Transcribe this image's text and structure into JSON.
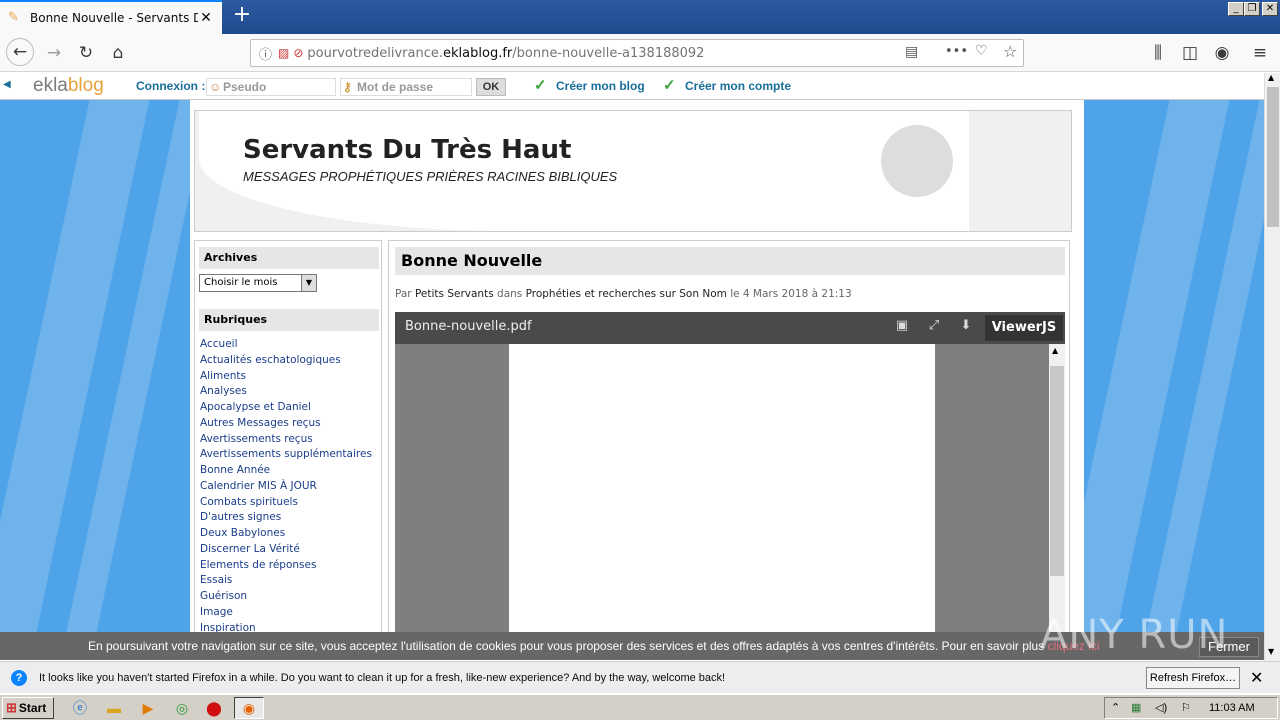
{
  "browser": {
    "tab_title": "Bonne Nouvelle - Servants Du Très Haut",
    "tab_title_visible": "Bonne Nouvelle - Servants Du Trè",
    "new_tab": "+",
    "url_plain_start": "pourvotredelivrance.",
    "url_domain": "eklablog.fr",
    "url_path": "/bonne-nouvelle-a138188092",
    "menu_dots": "•••"
  },
  "eklabar": {
    "logo_part1": "ekla",
    "logo_part2": "blog",
    "connexion_label": "Connexion :",
    "pseudo_placeholder": "Pseudo",
    "password_placeholder": "Mot de passe",
    "ok_label": "OK",
    "create_blog": "Créer mon blog",
    "create_account": "Créer mon compte"
  },
  "header": {
    "title": "Servants Du Très Haut",
    "subtitle": "MESSAGES PROPHÉTIQUES PRIÈRES RACINES BIBLIQUES"
  },
  "sidebar": {
    "archives_title": "Archives",
    "archives_select": "Choisir le mois",
    "rubriques_title": "Rubriques",
    "rubriques": [
      "Accueil",
      "Actualités eschatologiques",
      "Aliments",
      "Analyses",
      "Apocalypse et Daniel",
      "Autres Messages reçus",
      "Avertissements reçus",
      "Avertissements supplémentaires",
      "Bonne Année",
      "Calendrier MIS À JOUR",
      "Combats spirituels",
      "D'autres signes",
      "Deux Babylones",
      "Discerner La Vérité",
      "Elements de réponses",
      "Essais",
      "Guérison",
      "Image",
      "Inspiration"
    ]
  },
  "article": {
    "title": "Bonne Nouvelle",
    "meta_par": "Par",
    "meta_author": "Petits Servants",
    "meta_dans": "dans",
    "meta_category": "Prophéties et recherches sur Son Nom",
    "meta_date": "le 4 Mars 2018 à 21:13"
  },
  "viewer": {
    "filename": "Bonne-nouvelle.pdf",
    "brand": "ViewerJS"
  },
  "cookie": {
    "text": "En poursuivant votre navigation sur ce site, vous acceptez l'utilisation de cookies pour vous proposer des services et des offres adaptés à vos centres d'intérêts. Pour en savoir plus",
    "link": "cliquez ici",
    "close": "Fermer"
  },
  "watermark": "ANY RUN",
  "notification": {
    "text": "It looks like you haven't started Firefox in a while. Do you want to clean it up for a fresh, like-new experience? And by the way, welcome back!",
    "button": "Refresh Firefox…"
  },
  "taskbar": {
    "start": "Start",
    "clock": "11:03 AM"
  },
  "colors": {
    "page_background": "#4fa3e8",
    "link": "#1a3d8a",
    "eklabar_link": "#1a6e9a",
    "check": "#3aa33a"
  }
}
